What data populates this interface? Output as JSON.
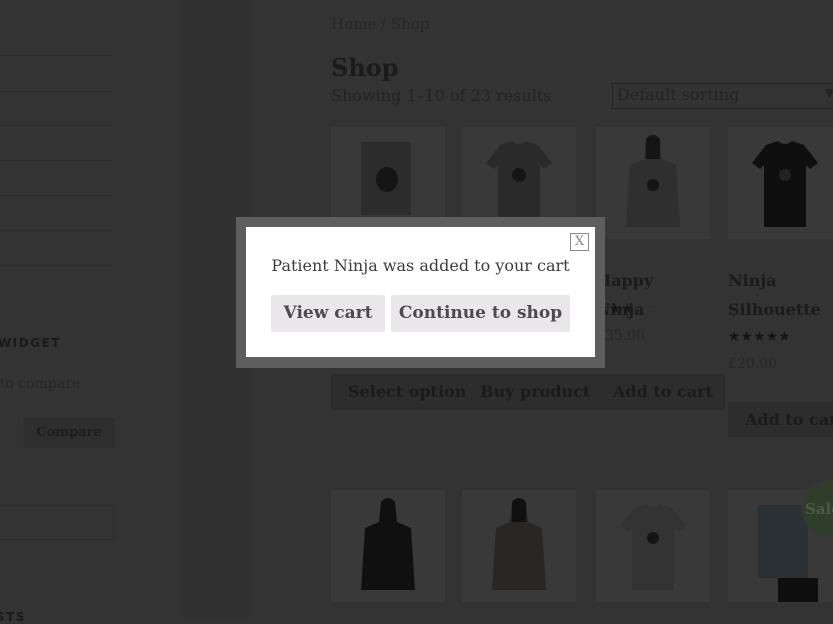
{
  "sidebar": {
    "widget_title": "WIDGET",
    "compare_text": "to compare",
    "compare_button": "Compare",
    "bottom_title": "STS"
  },
  "breadcrumb": "Home / Shop",
  "page_title": "Shop",
  "result_count": "Showing 1–10 of 23 results",
  "sort": {
    "selected": "Default sorting"
  },
  "products": [
    {
      "button": "Select options"
    },
    {
      "button": "Buy product"
    },
    {
      "title": "Happy Ninja",
      "rating": 3,
      "price": "£35.00",
      "button": "Add to cart"
    },
    {
      "title": "Ninja Silhouette",
      "rating": 5,
      "price": "£20.00",
      "button": "Add to cart"
    }
  ],
  "sale_badge": "Sale!",
  "modal": {
    "message": "Patient Ninja was added to your cart",
    "close": "X",
    "view_cart": "View cart",
    "continue": "Continue to shop"
  }
}
